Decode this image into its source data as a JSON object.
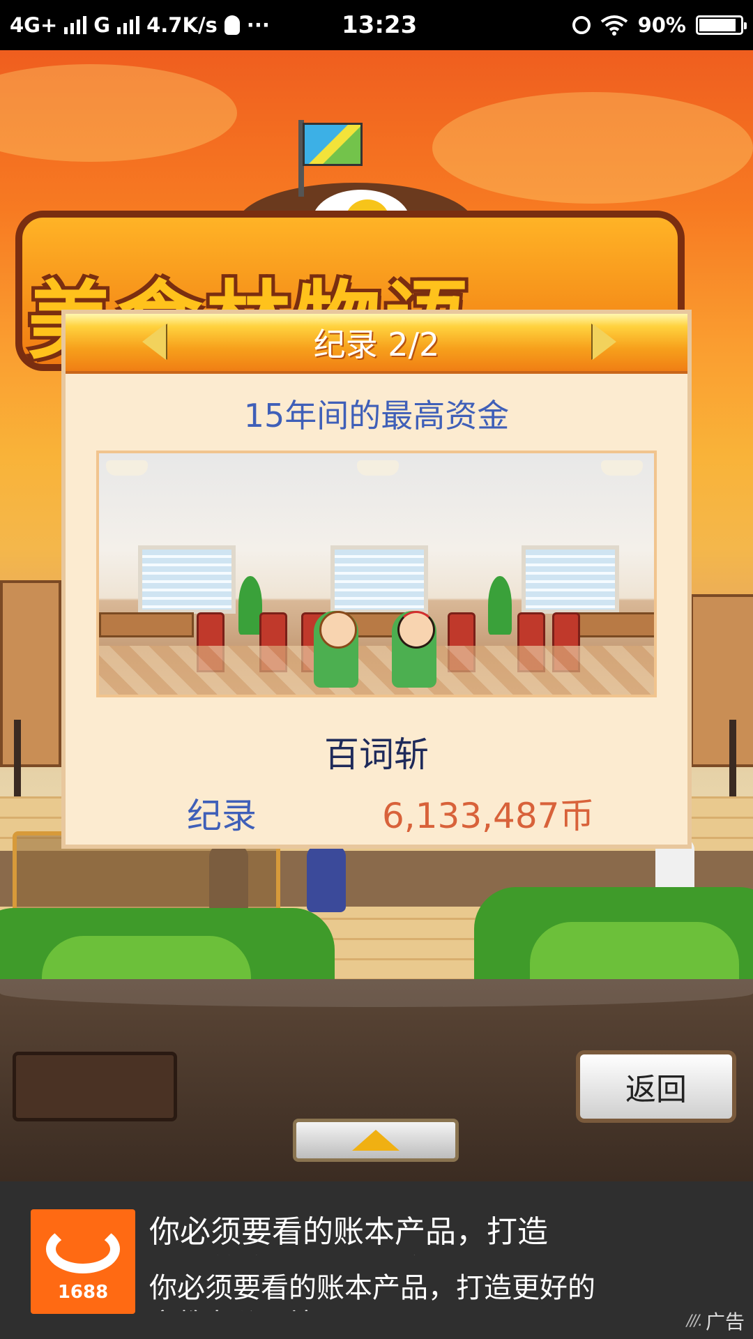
{
  "status_bar": {
    "network_1": "4G+",
    "network_2": "G",
    "speed": "4.7K/s",
    "dots": "···",
    "time": "13:23",
    "battery_text": "90%",
    "battery_level": 0.9,
    "icons": [
      "signal-bars-icon",
      "qq-penguin-icon",
      "alarm-icon",
      "wifi-icon",
      "battery-icon"
    ]
  },
  "game": {
    "logo_text": "美食林物语",
    "dialog": {
      "title": "纪录 2/2",
      "subtitle": "15年间的最高资金",
      "shop_name": "百词斩",
      "record_label": "纪录",
      "record_value": "6,133,487币"
    },
    "menu_card_label": "纪录",
    "back_button": "返回"
  },
  "ad": {
    "line1": "你必须要看的账本产品，打造",
    "line1_cut": "更好的文教办公环境",
    "line2": "你必须要看的账本产品，打造更好的",
    "line2_cut": "文教办公环境",
    "logo_number": "1688",
    "tag": "广告",
    "colors": {
      "logo_bg": "#ff6a13"
    }
  }
}
